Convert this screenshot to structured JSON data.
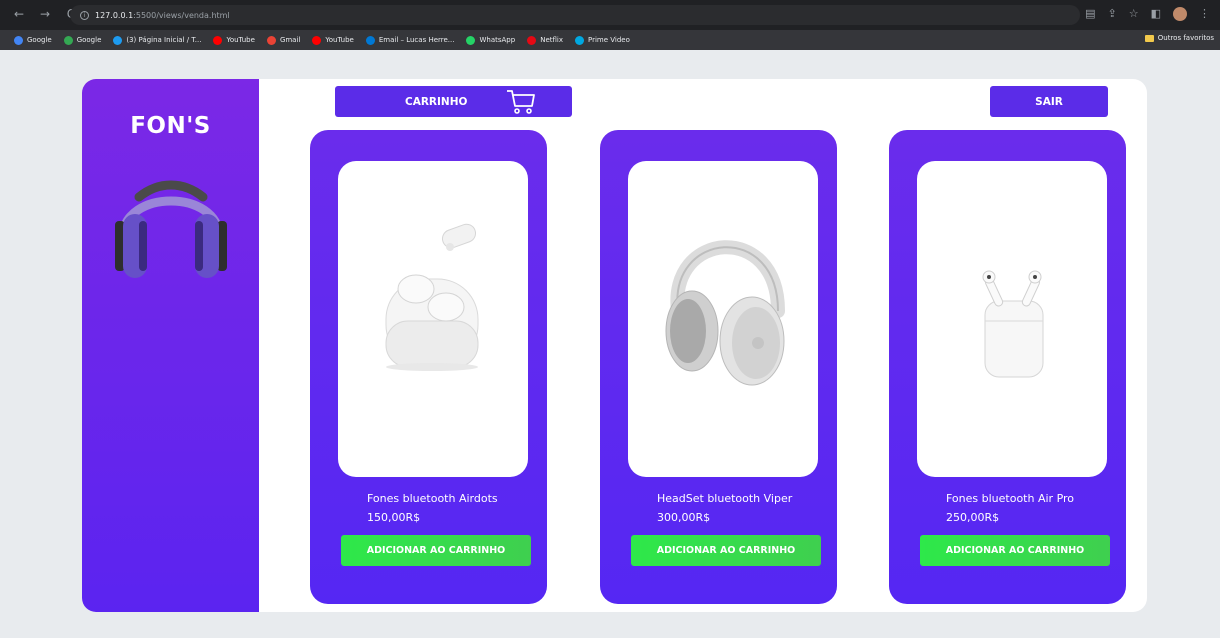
{
  "browser": {
    "nav": {
      "back": "←",
      "forward": "→",
      "reload": "C"
    },
    "address": {
      "host": "127.0.0.1",
      "path": ":5500/views/venda.html"
    },
    "bookmarks": [
      {
        "label": "Google",
        "color": "#4285f4"
      },
      {
        "label": "Google",
        "color": "#34a853"
      },
      {
        "label": "(3) Página Inicial / T...",
        "color": "#1d9bf0"
      },
      {
        "label": "YouTube",
        "color": "#ff0000"
      },
      {
        "label": "Gmail",
        "color": "#ea4335"
      },
      {
        "label": "YouTube",
        "color": "#ff0000"
      },
      {
        "label": "Email – Lucas Herre...",
        "color": "#0078d4"
      },
      {
        "label": "WhatsApp",
        "color": "#25d366"
      },
      {
        "label": "Netflix",
        "color": "#e50914"
      },
      {
        "label": "Prime Video",
        "color": "#00a8e1"
      }
    ],
    "other_bookmarks": "Outros favoritos"
  },
  "sidebar": {
    "brand": "FON'S"
  },
  "toolbar": {
    "cart_label": "CARRINHO",
    "exit_label": "SAIR"
  },
  "products": [
    {
      "name": "Fones bluetooth Airdots",
      "price": "150,00R$",
      "button": "ADICIONAR AO CARRINHO"
    },
    {
      "name": "HeadSet bluetooth Viper",
      "price": "300,00R$",
      "button": "ADICIONAR AO CARRINHO"
    },
    {
      "name": "Fones bluetooth Air Pro",
      "price": "250,00R$",
      "button": "ADICIONAR AO CARRINHO"
    }
  ],
  "colors": {
    "primary": "#5b2ce8",
    "sidebar_top": "#7b28e6",
    "button_green": "#2ee84a",
    "background": "#e8ebee"
  }
}
